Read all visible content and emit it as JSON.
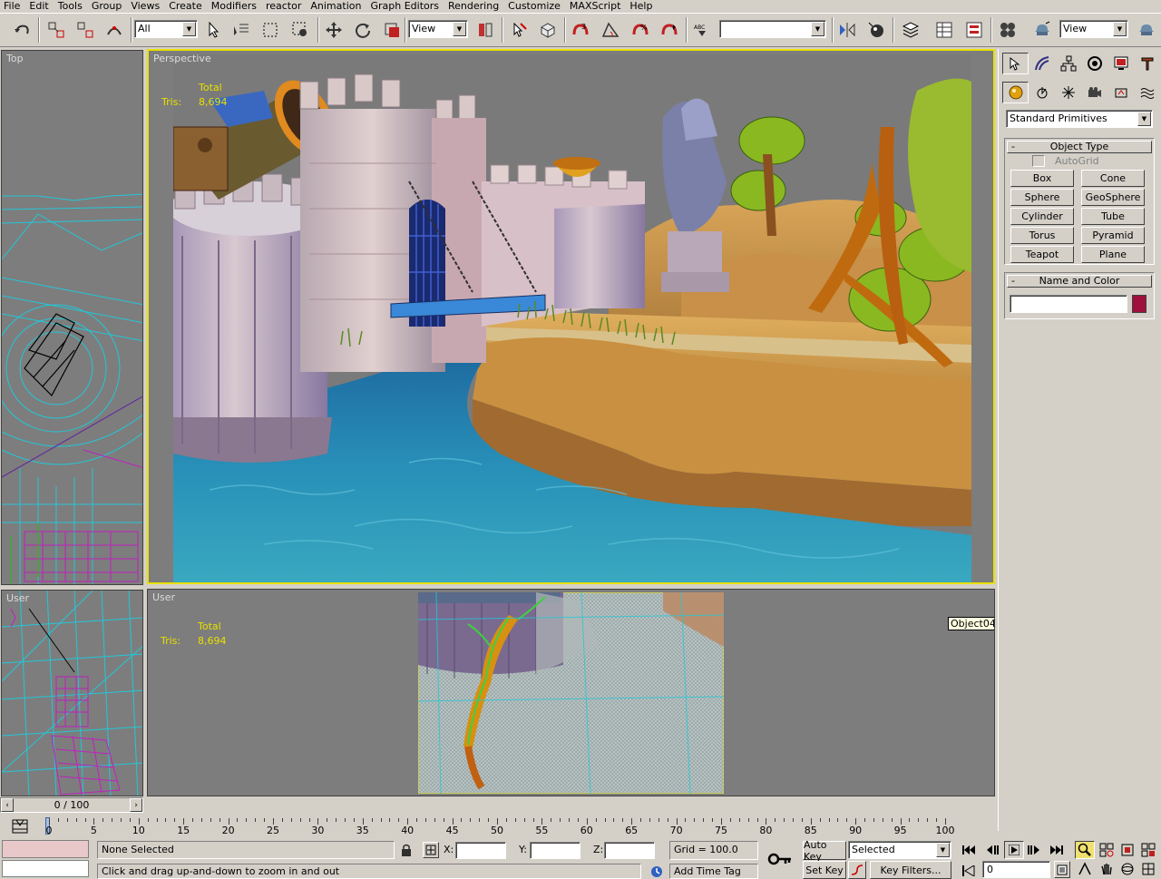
{
  "menu": [
    "File",
    "Edit",
    "Tools",
    "Group",
    "Views",
    "Create",
    "Modifiers",
    "reactor",
    "Animation",
    "Graph Editors",
    "Rendering",
    "Customize",
    "MAXScript",
    "Help"
  ],
  "toolbar": {
    "selection_filter": "All",
    "ref_coord": "View",
    "named_selection": "",
    "render_view": "View"
  },
  "viewports": {
    "top": {
      "label": "Top"
    },
    "perspective": {
      "label": "Perspective",
      "stats_total": "Total",
      "stats_tris_label": "Tris:",
      "stats_tris": "8,694"
    },
    "user_left": {
      "label": "User"
    },
    "user_main": {
      "label": "User",
      "stats_total": "Total",
      "stats_tris_label": "Tris:",
      "stats_tris": "8,694",
      "tooltip": "Object04"
    }
  },
  "scrub": {
    "frame": "0 / 100"
  },
  "timeline": {
    "ticks": [
      "0",
      "5",
      "10",
      "15",
      "20",
      "25",
      "30",
      "35",
      "40",
      "45",
      "50",
      "55",
      "60",
      "65",
      "70",
      "75",
      "80",
      "85",
      "90",
      "95",
      "100"
    ]
  },
  "command_panel": {
    "category": "Standard Primitives",
    "object_type_title": "Object Type",
    "autogrid": "AutoGrid",
    "buttons": [
      "Box",
      "Cone",
      "Sphere",
      "GeoSphere",
      "Cylinder",
      "Tube",
      "Torus",
      "Pyramid",
      "Teapot",
      "Plane"
    ],
    "name_color_title": "Name and Color",
    "name_value": "",
    "swatch_color": "#a0103c"
  },
  "status": {
    "selection": "None Selected",
    "prompt": "Click and drag up-and-down to zoom in and out",
    "x_label": "X:",
    "y_label": "Y:",
    "z_label": "Z:",
    "grid": "Grid = 100.0",
    "add_time_tag": "Add Time Tag",
    "auto_key": "Auto Key",
    "set_key": "Set Key",
    "key_mode": "Selected",
    "key_filters": "Key Filters...",
    "current_frame": "0"
  },
  "colors": {
    "viewport_bg": "#7d7d7d",
    "active_border": "#e8e000",
    "wire_cyan": "#22c8d8",
    "wire_magenta": "#c020c0"
  }
}
